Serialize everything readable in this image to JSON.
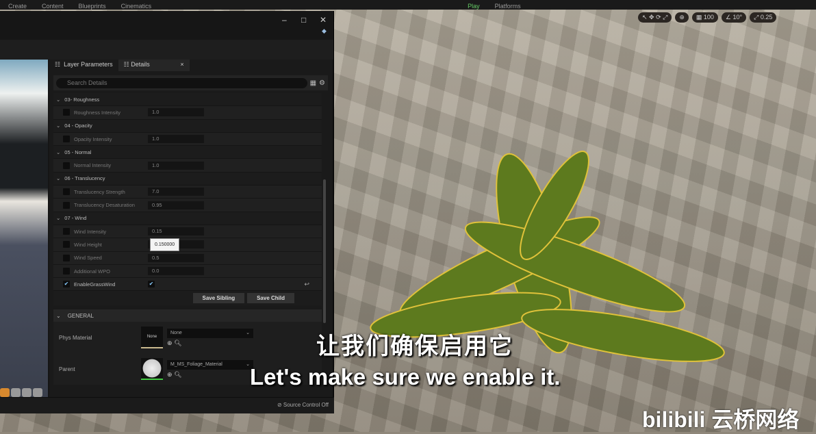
{
  "toolbar": {
    "items": [
      "Create",
      "Content",
      "Blueprints",
      "Cinematics"
    ],
    "play": "Play",
    "platforms": "Platforms"
  },
  "viewport_tools": {
    "grid": "100",
    "angle": "10°",
    "scale": "0.25"
  },
  "tabs": {
    "layer_parameters": "Layer Parameters",
    "details": "Details",
    "close": "×"
  },
  "search": {
    "placeholder": "Search Details"
  },
  "sections": [
    {
      "title": "03- Roughness",
      "params": [
        {
          "label": "Roughness Intensity",
          "value": "1.0"
        }
      ]
    },
    {
      "title": "04 - Opacity",
      "params": [
        {
          "label": "Opacity Intensity",
          "value": "1.0"
        }
      ]
    },
    {
      "title": "05 - Normal",
      "params": [
        {
          "label": "Normal Intensity",
          "value": "1.0"
        }
      ]
    },
    {
      "title": "06 - Translucency",
      "params": [
        {
          "label": "Translucency Strength",
          "value": "7.0"
        },
        {
          "label": "Translucency Desaturation",
          "value": "0.95"
        }
      ]
    },
    {
      "title": "07 - Wind",
      "params": [
        {
          "label": "Wind Intensity",
          "value": "0.15"
        },
        {
          "label": "Wind Height",
          "value": ""
        },
        {
          "label": "Wind Speed",
          "value": "0.5"
        },
        {
          "label": "Additional WPO",
          "value": "0.0"
        }
      ]
    }
  ],
  "enable_grass_wind": {
    "label": "EnableGrassWind",
    "checked": true
  },
  "tooltip": "0.150000",
  "buttons": {
    "save_sibling": "Save Sibling",
    "save_child": "Save Child"
  },
  "general": {
    "title": "GENERAL",
    "phys_material": {
      "label": "Phys Material",
      "thumb": "None",
      "value": "None"
    },
    "parent": {
      "label": "Parent",
      "value": "M_MS_Foliage_Material"
    }
  },
  "status": {
    "source_control": "Source Control Off"
  },
  "subtitles": {
    "cn": "让我们确保启用它",
    "en": "Let's make sure we enable it."
  },
  "watermark": "bilibili 云桥网络"
}
